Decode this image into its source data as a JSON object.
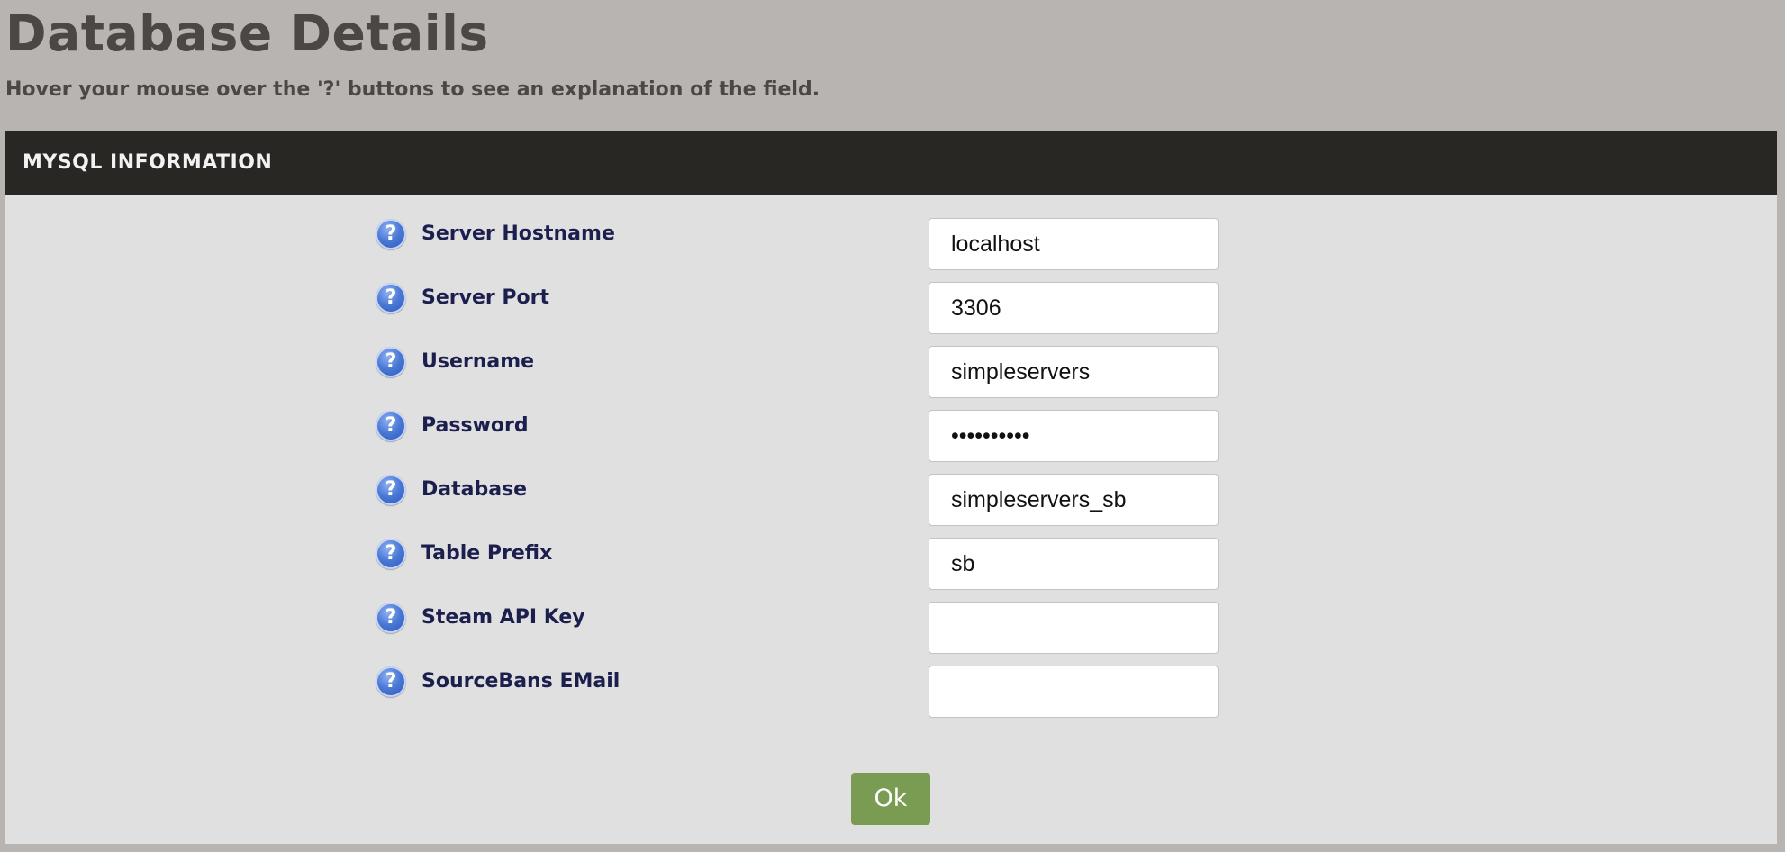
{
  "page": {
    "title": "Database Details",
    "subtitle": "Hover your mouse over the '?' buttons to see an explanation of the field."
  },
  "panel": {
    "header": "MYSQL INFORMATION"
  },
  "help_icon": {
    "glyph": "?",
    "icon": "question-mark-icon",
    "color": "#3f6fd1"
  },
  "fields": [
    {
      "label": "Server Hostname",
      "value": "localhost",
      "type": "text"
    },
    {
      "label": "Server Port",
      "value": "3306",
      "type": "text"
    },
    {
      "label": "Username",
      "value": "simpleservers",
      "type": "text"
    },
    {
      "label": "Password",
      "value": "simpleserv",
      "type": "password"
    },
    {
      "label": "Database",
      "value": "simpleservers_sb",
      "type": "text"
    },
    {
      "label": "Table Prefix",
      "value": "sb",
      "type": "text"
    },
    {
      "label": "Steam API Key",
      "value": "",
      "type": "text"
    },
    {
      "label": "SourceBans EMail",
      "value": "",
      "type": "text"
    }
  ],
  "ok_button": {
    "label": "Ok",
    "color": "#7a9c52"
  },
  "colors": {
    "background": "#b8b4b1",
    "panel": "#e0e0e0",
    "panel_header": "#282724",
    "label_text": "#1c1f4d"
  }
}
